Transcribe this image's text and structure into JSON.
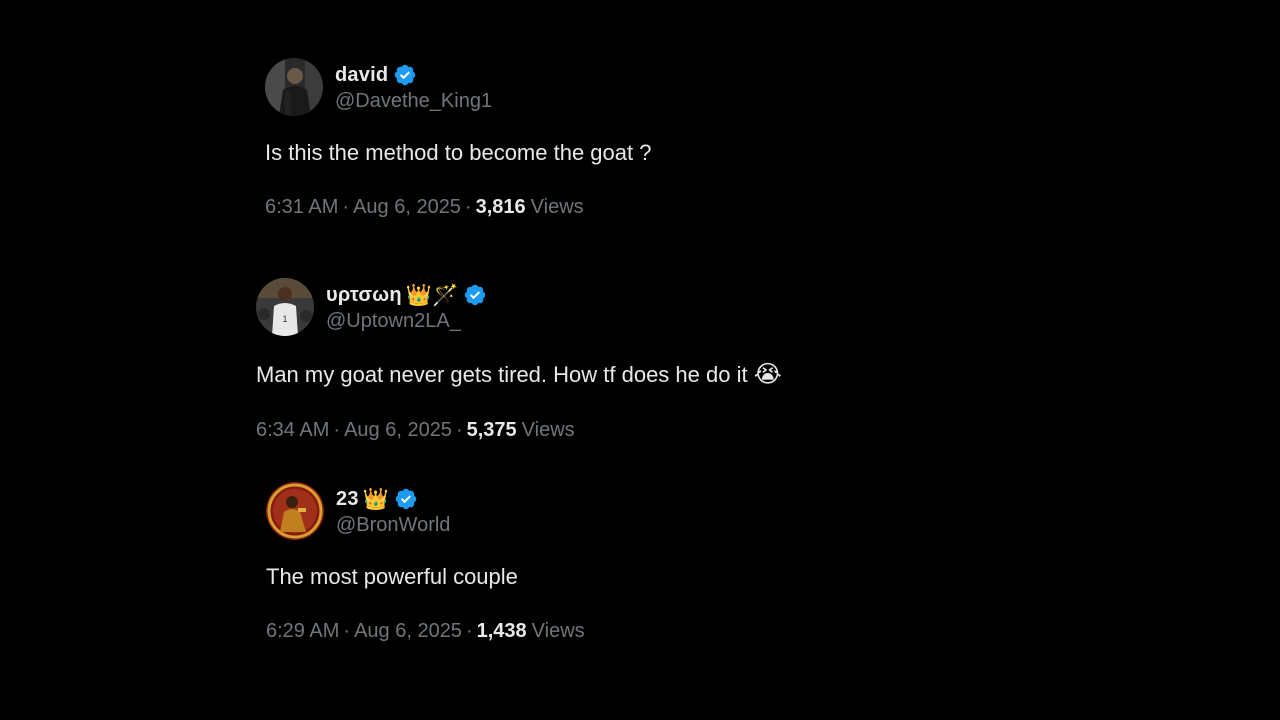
{
  "colors": {
    "background": "#000000",
    "primary_text": "#e7e9ea",
    "secondary_text": "#71767b",
    "verified_badge": "#1d9bf0"
  },
  "tweets": [
    {
      "display_name": "david",
      "name_emojis": "",
      "handle": "@Davethe_King1",
      "verified": true,
      "text": "Is this the method to become the goat ?",
      "text_emoji": "",
      "time": "6:31 AM",
      "date": "Aug 6, 2025",
      "views_count": "3,816",
      "views_label": "Views",
      "separator": "·"
    },
    {
      "display_name": "υρτσωη",
      "name_emojis": "👑🪄",
      "handle": "@Uptown2LA_",
      "verified": true,
      "text": "Man my goat never gets tired. How tf does he do it",
      "text_emoji": "😭",
      "time": "6:34 AM",
      "date": "Aug 6, 2025",
      "views_count": "5,375",
      "views_label": "Views",
      "separator": "·"
    },
    {
      "display_name": "23",
      "name_emojis": "👑",
      "handle": "@BronWorld",
      "verified": true,
      "text": "The most powerful couple",
      "text_emoji": "",
      "time": "6:29 AM",
      "date": "Aug 6, 2025",
      "views_count": "1,438",
      "views_label": "Views",
      "separator": "·"
    }
  ]
}
